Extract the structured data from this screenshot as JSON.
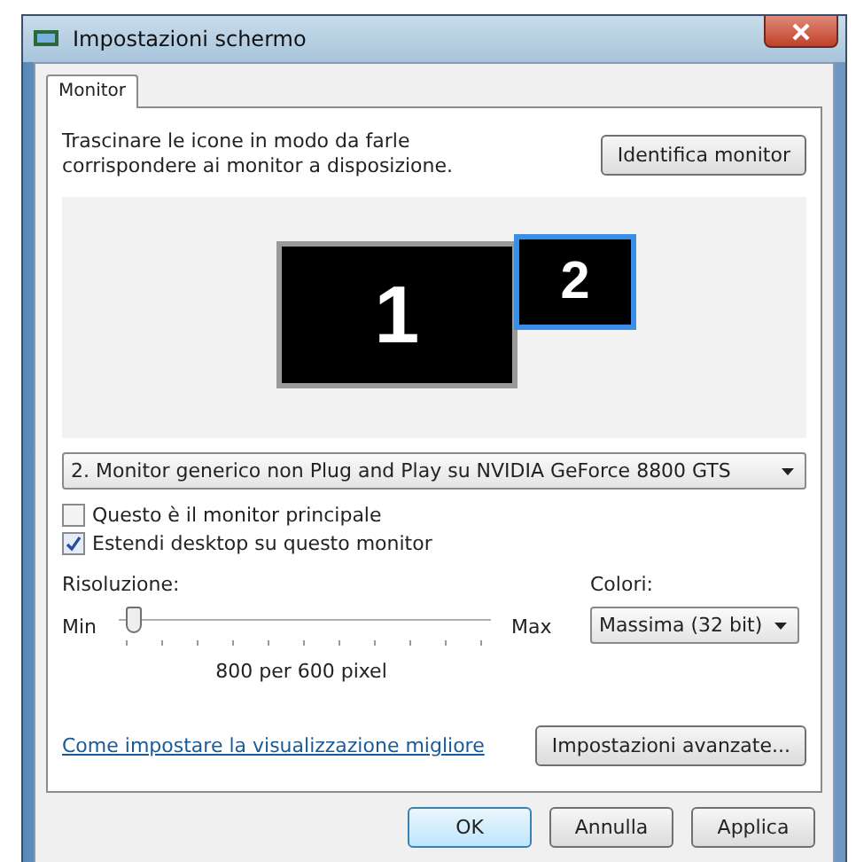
{
  "window": {
    "title": "Impostazioni schermo"
  },
  "tabs": [
    {
      "label": "Monitor",
      "selected": true
    }
  ],
  "instructions": "Trascinare le icone in modo da farle corrispondere ai monitor a disposizione.",
  "identify_button": "Identifica monitor",
  "monitors": [
    {
      "number": "1",
      "selected": false
    },
    {
      "number": "2",
      "selected": true
    }
  ],
  "monitor_select": {
    "value": "2. Monitor generico non Plug and Play su NVIDIA GeForce 8800 GTS"
  },
  "checkboxes": [
    {
      "label": "Questo è il monitor principale",
      "checked": false
    },
    {
      "label": "Estendi desktop su questo monitor",
      "checked": true
    }
  ],
  "resolution": {
    "label": "Risoluzione:",
    "min": "Min",
    "max": "Max",
    "level": 0.02,
    "reading": "800 per 600 pixel"
  },
  "colors": {
    "label": "Colori:",
    "value": "Massima (32 bit)"
  },
  "help_link": "Come impostare la visualizzazione migliore",
  "advanced_button": "Impostazioni avanzate...",
  "buttons": [
    {
      "label": "OK",
      "default": true
    },
    {
      "label": "Annulla",
      "default": false
    },
    {
      "label": "Applica",
      "default": false
    }
  ]
}
